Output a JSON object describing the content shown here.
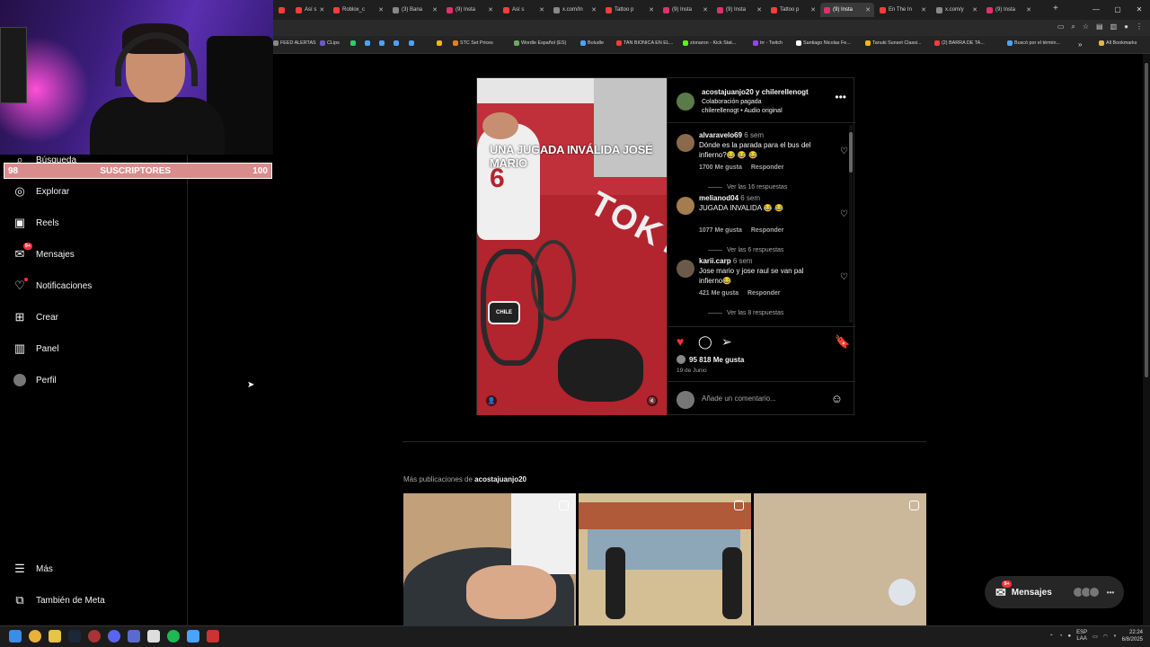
{
  "browser": {
    "tabs": [
      {
        "label": "",
        "color": "#ff3b3b"
      },
      {
        "label": "Así s",
        "color": "#ff3b3b"
      },
      {
        "label": "Roblox_c",
        "color": "#ff3b3b"
      },
      {
        "label": "(3) Bana",
        "color": "#888888"
      },
      {
        "label": "(9) Insta",
        "color": "#e1306c"
      },
      {
        "label": "Así s",
        "color": "#ff3b3b"
      },
      {
        "label": "x.com/In",
        "color": "#888888"
      },
      {
        "label": "Tattoo p",
        "color": "#ff3b3b"
      },
      {
        "label": "(9) Insta",
        "color": "#e1306c"
      },
      {
        "label": "(9) Insta",
        "color": "#e1306c"
      },
      {
        "label": "Tattoo p",
        "color": "#ff3b3b"
      },
      {
        "label": "(9) Insta",
        "color": "#e1306c"
      },
      {
        "label": "En The In",
        "color": "#ff3b3b"
      },
      {
        "label": "x.com/y",
        "color": "#888888"
      },
      {
        "label": "(9) Insta",
        "color": "#e1306c"
      }
    ],
    "new_tab": "+",
    "bookmarks": [
      {
        "label": "FEED ALERTAS",
        "color": "#888888"
      },
      {
        "label": "CLips",
        "color": "#6a5acd"
      },
      {
        "label": "",
        "color": "#2ecc71"
      },
      {
        "label": "",
        "color": "#4aa3ff"
      },
      {
        "label": "",
        "color": "#4aa3ff"
      },
      {
        "label": "",
        "color": "#4aa3ff"
      },
      {
        "label": "",
        "color": "#4aa3ff"
      },
      {
        "label": "",
        "color": "#f0b90b"
      },
      {
        "label": "STC Set Prices",
        "color": "#e67e22"
      },
      {
        "label": "Wordle Español (ES)",
        "color": "#6aaa64"
      },
      {
        "label": "Boludle",
        "color": "#4aa3ff"
      },
      {
        "label": "TAN BIONICA EN EL...",
        "color": "#ff3b3b"
      },
      {
        "label": "zionaron - Kick Stat...",
        "color": "#53fc18"
      },
      {
        "label": "trr - Twitch",
        "color": "#9146ff"
      },
      {
        "label": "Santiago Nicolas Fe...",
        "color": "#ffffff"
      },
      {
        "label": "Tanuki Sunset Classi...",
        "color": "#f0b90b"
      },
      {
        "label": "(2) BARRA DE TA...",
        "color": "#ff3b3b"
      },
      {
        "label": "Buscó por el términ...",
        "color": "#4aa3ff"
      }
    ],
    "all_bookmarks": "All Bookmarks"
  },
  "overlay": {
    "subs_current": "98",
    "subs_label": "SUSCRIPTORES",
    "subs_goal": "100"
  },
  "sidebar": {
    "items": [
      {
        "label": "Búsqueda",
        "icon": "search-icon"
      },
      {
        "label": "Explorar",
        "icon": "compass-icon"
      },
      {
        "label": "Reels",
        "icon": "reels-icon"
      },
      {
        "label": "Mensajes",
        "icon": "messenger-icon",
        "badge": "9+"
      },
      {
        "label": "Notificaciones",
        "icon": "heart-icon"
      },
      {
        "label": "Crear",
        "icon": "plus-square-icon"
      },
      {
        "label": "Panel",
        "icon": "chart-icon"
      },
      {
        "label": "Perfil",
        "icon": "avatar-icon"
      }
    ],
    "bottom": [
      {
        "label": "Más",
        "icon": "menu-icon"
      },
      {
        "label": "También de Meta",
        "icon": "meta-icon"
      }
    ]
  },
  "post": {
    "video_caption": "UNA JUGADA INVÁLIDA JOSÉ MARIO",
    "video_logo": "CHILE",
    "video_court_text": "TOKYO",
    "header_line1": "acostajuanjo20 y chilerellenogt",
    "header_line2": "Colaboración pagada",
    "header_line3": "chilerellenogt • Audio original",
    "comments": [
      {
        "user": "alvaravelo69",
        "ago": "6 sem",
        "text": "Dónde es la parada para el bus del infierno?😂 😂 😂",
        "likes": "1700 Me gusta",
        "reply": "Responder",
        "replies": "Ver las 16 respuestas"
      },
      {
        "user": "melianod04",
        "ago": "6 sem",
        "text": "JUGADA INVALIDA 😂 😂",
        "likes": "1077 Me gusta",
        "reply": "Responder",
        "replies": "Ver las 6 respuestas"
      },
      {
        "user": "karii.carp",
        "ago": "6 sem",
        "text": "Jose mario y jose raul se van pal infierno😂",
        "likes": "421 Me gusta",
        "reply": "Responder",
        "replies": "Ver las 8 respuestas"
      }
    ],
    "likes_count": "95 818 Me gusta",
    "date": "19 de Junio",
    "add_comment_placeholder": "Añade un comentario..."
  },
  "more": {
    "prefix": "Más publicaciones de",
    "user": "acostajuanjo20"
  },
  "messages_pill": {
    "label": "Mensajes",
    "badge": "9+"
  },
  "taskbar": {
    "lang_1": "ESP",
    "lang_2": "LAA",
    "time": "22:24",
    "date": "6/8/2025"
  }
}
